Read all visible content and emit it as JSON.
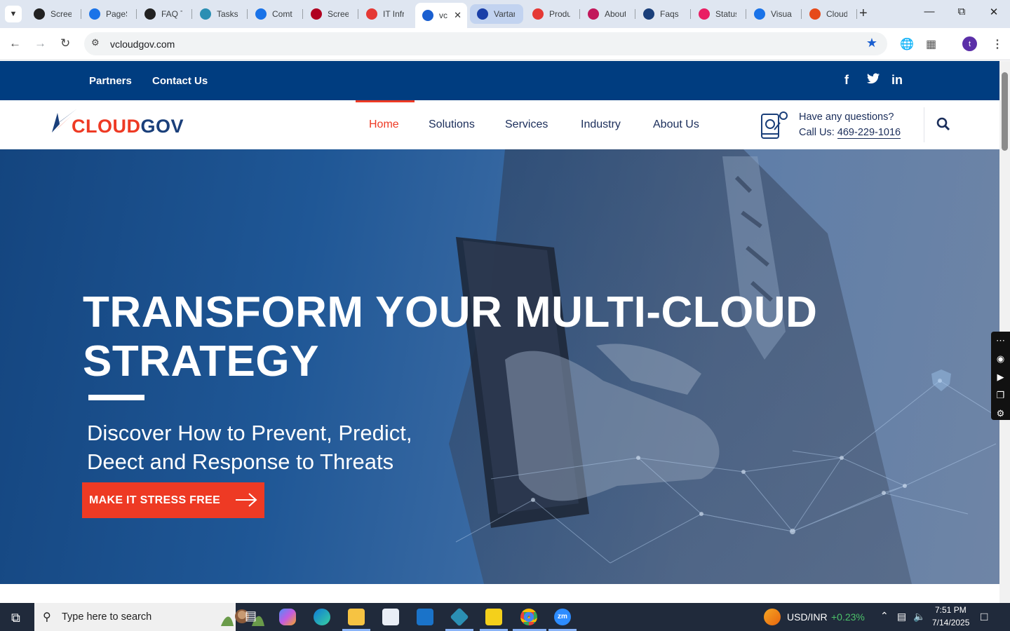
{
  "browser": {
    "tabs": [
      {
        "label": "Scree",
        "color": "#222"
      },
      {
        "label": "PageS",
        "color": "#1a73e8"
      },
      {
        "label": "FAQ T",
        "color": "#222"
      },
      {
        "label": "Tasks",
        "color": "#2b8fb3"
      },
      {
        "label": "Comt",
        "color": "#1a73e8"
      },
      {
        "label": "Scree",
        "color": "#b00020"
      },
      {
        "label": "IT Infr",
        "color": "#e53935"
      },
      {
        "label": "vc",
        "color": "#1a5fd0",
        "active": true
      },
      {
        "label": "Vartar",
        "color": "#1a3fa8",
        "highlight": true
      },
      {
        "label": "Produ",
        "color": "#e53935"
      },
      {
        "label": "About",
        "color": "#c2185b"
      },
      {
        "label": "Faqs -",
        "color": "#1a3f7a"
      },
      {
        "label": "Status",
        "color": "#e91e63"
      },
      {
        "label": "Visua",
        "color": "#1a73e8"
      },
      {
        "label": "Cloud",
        "color": "#e64a19"
      }
    ],
    "url": "vcloudgov.com",
    "profile_initial": "t"
  },
  "site": {
    "topbar": {
      "links": [
        "Partners",
        "Contact Us"
      ],
      "social": [
        "f",
        "t",
        "in"
      ]
    },
    "logo": {
      "part1": "CLOUD",
      "part2": "GOV"
    },
    "nav": [
      "Home",
      "Solutions",
      "Services",
      "Industry",
      "About Us"
    ],
    "contact": {
      "question": "Have any questions?",
      "call_prefix": "Call Us: ",
      "phone": "469-229-1016"
    },
    "hero": {
      "title_line1": "TRANSFORM YOUR MULTI-CLOUD",
      "title_line2": "STRATEGY",
      "subtitle_line1": "Discover How to Prevent, Predict,",
      "subtitle_line2": "Deect and Response to Threats",
      "cta": "MAKE IT STRESS FREE"
    }
  },
  "taskbar": {
    "search_placeholder": "Type here to search",
    "ticker": "USD/INR",
    "ticker_change": "+0.23%",
    "time": "7:51 PM",
    "date": "7/14/2025"
  },
  "colors": {
    "brand_blue": "#003d80",
    "brand_red": "#ee3a24",
    "navy_text": "#1a2d5a"
  }
}
